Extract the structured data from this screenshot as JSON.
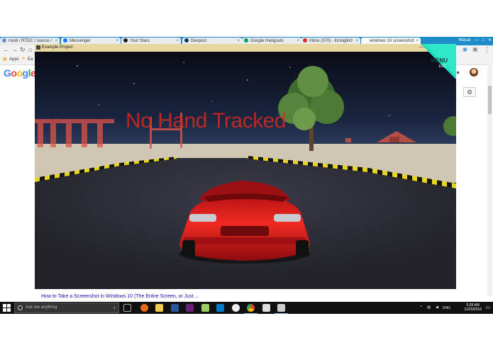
{
  "browser": {
    "tabs": [
      {
        "label": "rsiu6 / RTDC / source /",
        "color": "#6b8ecf",
        "active": false
      },
      {
        "label": "Messenger",
        "color": "#1877f2",
        "active": false
      },
      {
        "label": "Your Stars",
        "color": "#222222",
        "active": false
      },
      {
        "label": "Devpost",
        "color": "#003e54",
        "active": false
      },
      {
        "label": "Google Hangouts",
        "color": "#0f9d58",
        "active": false
      },
      {
        "label": "Inbox (370) - lizonglin0",
        "color": "#d93025",
        "active": false
      },
      {
        "label": "windows 10 screenshot",
        "color": "#ffffff",
        "active": true
      }
    ],
    "window_user": "Wasat",
    "bookmarks": {
      "apps_label": "Apps",
      "item_label": "Ea"
    },
    "google_logo": [
      "G",
      "o",
      "o",
      "g",
      "l",
      "e"
    ],
    "search_result_title": "How to Take a Screenshot in Windows 10 (The Entire Screen, or Just ..."
  },
  "game_window": {
    "title": "Example Project",
    "overlay_text": "No Hand Tracked",
    "menu_label": "MENU",
    "menu_sublabel": "ESC",
    "colors": {
      "menu_accent": "#1ee0c0",
      "overlay_text": "#d42a1f",
      "car_body": "#d0181a",
      "sky": "#0a0e1a",
      "road": "#2e2e36"
    }
  },
  "taskbar": {
    "search_placeholder": "Ask me anything",
    "lang": "ENG",
    "time": "5:28 AM",
    "date": "11/20/2016",
    "pinned_icons": [
      "edge-icon",
      "task-view-icon",
      "firefox-icon",
      "file-explorer-icon",
      "word-icon",
      "visual-studio-icon",
      "notepad-icon",
      "vscode-icon",
      "unity-icon",
      "chrome-icon",
      "unity-app-icon"
    ]
  }
}
